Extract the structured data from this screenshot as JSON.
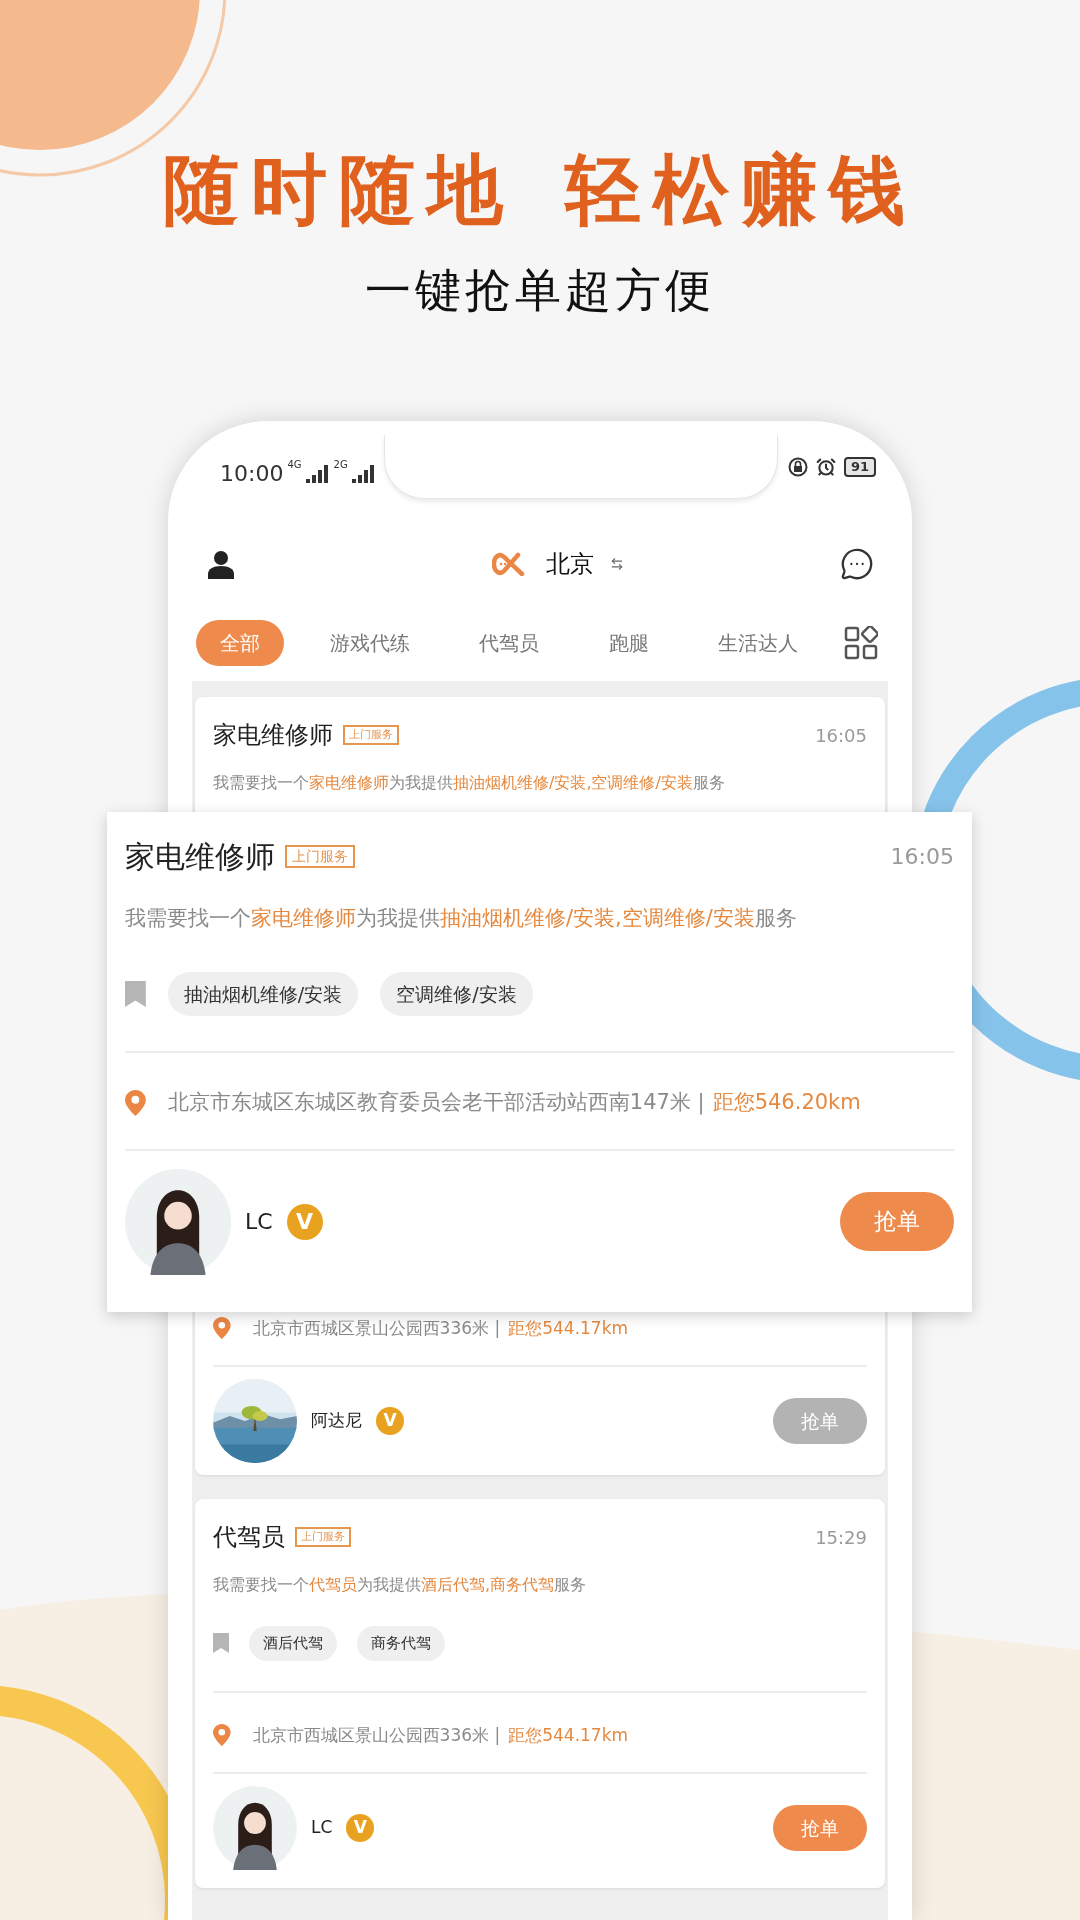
{
  "headline": [
    "随时随地",
    "轻松赚钱"
  ],
  "subheadline": "一键抢单超方便",
  "status_bar": {
    "time": "10:00",
    "network_1": "4G",
    "network_2": "2G",
    "battery": "91"
  },
  "header": {
    "city": "北京"
  },
  "tabs": [
    {
      "label": "全部",
      "selected": true
    },
    {
      "label": "游戏代练",
      "selected": false
    },
    {
      "label": "代驾员",
      "selected": false
    },
    {
      "label": "跑腿",
      "selected": false
    },
    {
      "label": "生活达人",
      "selected": false
    }
  ],
  "orders": [
    {
      "title": "家电维修师",
      "badge": "上门服务",
      "time": "16:05",
      "description": [
        {
          "text": "我需要找一个",
          "highlight": false
        },
        {
          "text": "家电维修师",
          "highlight": true
        },
        {
          "text": "为我提供",
          "highlight": false
        },
        {
          "text": "抽油烟机维修/安装,空调维修/安装",
          "highlight": true
        },
        {
          "text": "服务",
          "highlight": false
        }
      ]
    },
    {
      "address": "北京市西城区景山公园西336米 |",
      "distance": "距您544.17km",
      "user": {
        "name": "阿达尼",
        "vip": "V"
      },
      "button": {
        "label": "抢单",
        "disabled": true
      }
    },
    {
      "title": "代驾员",
      "badge": "上门服务",
      "time": "15:29",
      "description": [
        {
          "text": "我需要找一个",
          "highlight": false
        },
        {
          "text": "代驾员",
          "highlight": true
        },
        {
          "text": "为我提供",
          "highlight": false
        },
        {
          "text": "酒后代驾,商务代驾",
          "highlight": true
        },
        {
          "text": "服务",
          "highlight": false
        }
      ],
      "tags": [
        "酒后代驾",
        "商务代驾"
      ],
      "address": "北京市西城区景山公园西336米 |",
      "distance": "距您544.17km",
      "user": {
        "name": "LC",
        "vip": "V",
        "avatar": {
          "kind": "figure"
        }
      },
      "button": {
        "label": "抢单",
        "disabled": false
      }
    }
  ],
  "featured_order": {
    "title": "家电维修师",
    "badge": "上门服务",
    "time": "16:05",
    "description": [
      {
        "text": "我需要找一个",
        "highlight": false
      },
      {
        "text": "家电维修师",
        "highlight": true
      },
      {
        "text": "为我提供",
        "highlight": false
      },
      {
        "text": "抽油烟机维修/安装,空调维修/安装",
        "highlight": true
      },
      {
        "text": "服务",
        "highlight": false
      }
    ],
    "tags": [
      "抽油烟机维修/安装",
      "空调维修/安装"
    ],
    "address": "北京市东城区东城区教育委员会老干部活动站西南147米 |",
    "distance": "距您546.20km",
    "user": {
      "name": "LC",
      "vip": "V",
      "avatar": {
        "kind": "figure"
      }
    },
    "button": {
      "label": "抢单",
      "disabled": false
    }
  }
}
